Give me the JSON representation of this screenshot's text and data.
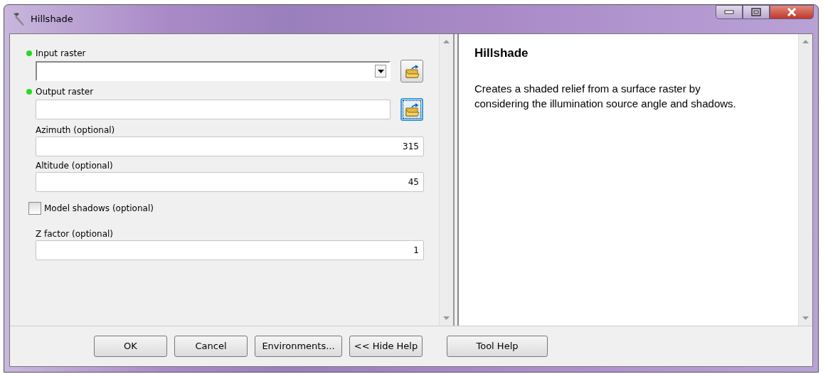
{
  "window": {
    "title": "Hillshade"
  },
  "params": [
    {
      "kind": "combo",
      "label": "Input raster",
      "required": true,
      "browse": {
        "focused": false
      }
    },
    {
      "kind": "text",
      "label": "Output raster",
      "required": true,
      "browse": {
        "focused": true
      }
    },
    {
      "kind": "text",
      "label": "Azimuth (optional)",
      "required": false,
      "value": "315"
    },
    {
      "kind": "text",
      "label": "Altitude (optional)",
      "required": false,
      "value": "45"
    },
    {
      "kind": "checkbox",
      "label": "Model shadows (optional)",
      "checked": false
    },
    {
      "kind": "text",
      "label": "Z factor (optional)",
      "required": false,
      "value": "1"
    }
  ],
  "help": {
    "title": "Hillshade",
    "body": "Creates a shaded relief from a surface raster by considering the illumination source angle and shadows."
  },
  "buttons": [
    {
      "label": "OK",
      "kind": "action"
    },
    {
      "label": "Cancel",
      "kind": "action"
    },
    {
      "label": "Environments...",
      "kind": "action"
    },
    {
      "label": "<< Hide Help",
      "kind": "action"
    },
    {
      "label": "Tool Help",
      "kind": "help"
    }
  ]
}
